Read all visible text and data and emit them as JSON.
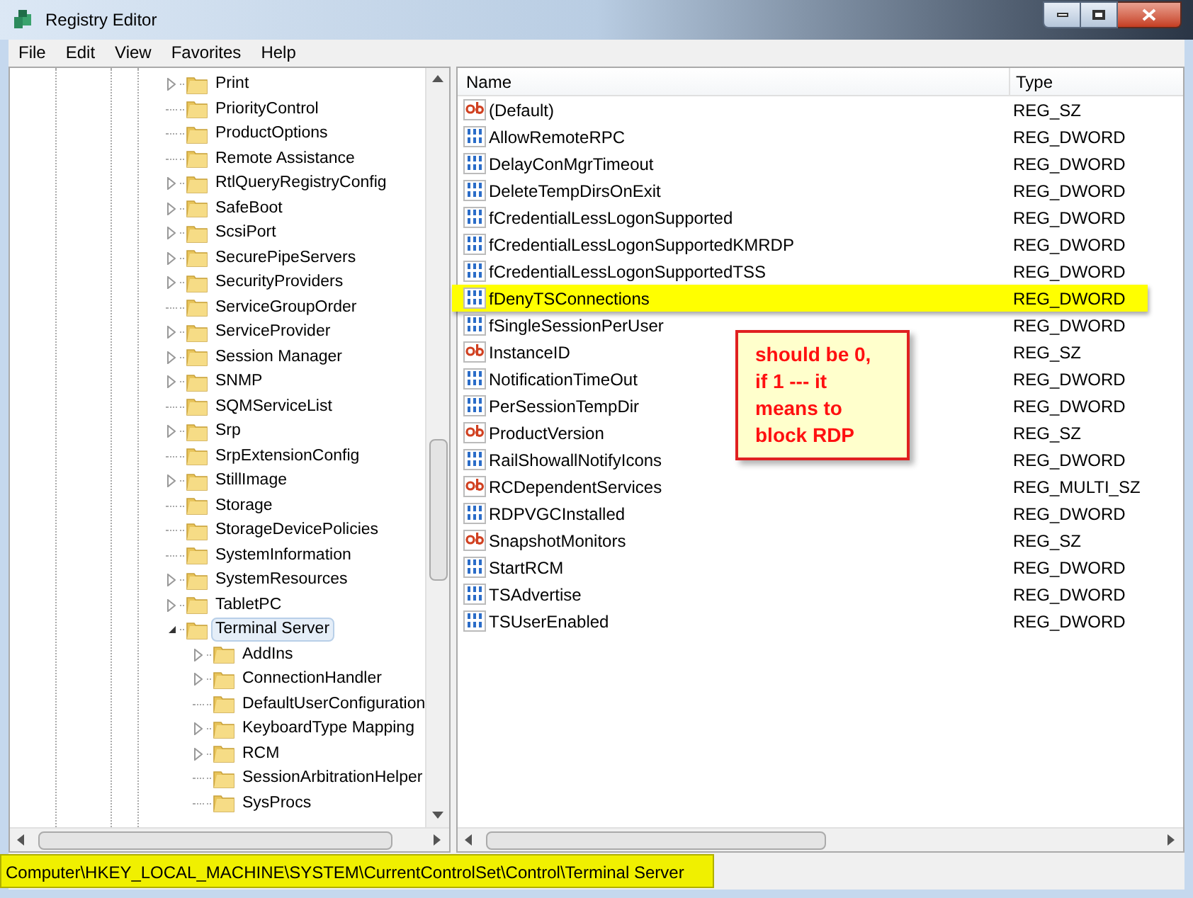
{
  "window": {
    "title": "Registry Editor"
  },
  "menu": [
    "File",
    "Edit",
    "View",
    "Favorites",
    "Help"
  ],
  "tree": [
    {
      "label": "Print",
      "expandable": true,
      "selected": false
    },
    {
      "label": "PriorityControl",
      "expandable": false,
      "selected": false
    },
    {
      "label": "ProductOptions",
      "expandable": false,
      "selected": false
    },
    {
      "label": "Remote Assistance",
      "expandable": false,
      "selected": false
    },
    {
      "label": "RtlQueryRegistryConfig",
      "expandable": true,
      "selected": false
    },
    {
      "label": "SafeBoot",
      "expandable": true,
      "selected": false
    },
    {
      "label": "ScsiPort",
      "expandable": true,
      "selected": false
    },
    {
      "label": "SecurePipeServers",
      "expandable": true,
      "selected": false
    },
    {
      "label": "SecurityProviders",
      "expandable": true,
      "selected": false
    },
    {
      "label": "ServiceGroupOrder",
      "expandable": false,
      "selected": false
    },
    {
      "label": "ServiceProvider",
      "expandable": true,
      "selected": false
    },
    {
      "label": "Session Manager",
      "expandable": true,
      "selected": false
    },
    {
      "label": "SNMP",
      "expandable": true,
      "selected": false
    },
    {
      "label": "SQMServiceList",
      "expandable": false,
      "selected": false
    },
    {
      "label": "Srp",
      "expandable": true,
      "selected": false
    },
    {
      "label": "SrpExtensionConfig",
      "expandable": false,
      "selected": false
    },
    {
      "label": "StillImage",
      "expandable": true,
      "selected": false
    },
    {
      "label": "Storage",
      "expandable": false,
      "selected": false
    },
    {
      "label": "StorageDevicePolicies",
      "expandable": false,
      "selected": false
    },
    {
      "label": "SystemInformation",
      "expandable": false,
      "selected": false
    },
    {
      "label": "SystemResources",
      "expandable": true,
      "selected": false
    },
    {
      "label": "TabletPC",
      "expandable": true,
      "selected": false
    },
    {
      "label": "Terminal Server",
      "expandable": true,
      "expanded": true,
      "selected": true,
      "children": [
        {
          "label": "AddIns",
          "expandable": true,
          "selected": false
        },
        {
          "label": "ConnectionHandler",
          "expandable": true,
          "selected": false
        },
        {
          "label": "DefaultUserConfiguration",
          "expandable": false,
          "selected": false
        },
        {
          "label": "KeyboardType Mapping",
          "expandable": true,
          "selected": false
        },
        {
          "label": "RCM",
          "expandable": true,
          "selected": false
        },
        {
          "label": "SessionArbitrationHelper",
          "expandable": false,
          "selected": false
        },
        {
          "label": "SysProcs",
          "expandable": false,
          "selected": false
        }
      ]
    }
  ],
  "table": {
    "columns": [
      "Name",
      "Type"
    ],
    "rows": [
      {
        "name": "(Default)",
        "type": "REG_SZ",
        "kind": "string",
        "highlighted": false
      },
      {
        "name": "AllowRemoteRPC",
        "type": "REG_DWORD",
        "kind": "binary",
        "highlighted": false
      },
      {
        "name": "DelayConMgrTimeout",
        "type": "REG_DWORD",
        "kind": "binary",
        "highlighted": false
      },
      {
        "name": "DeleteTempDirsOnExit",
        "type": "REG_DWORD",
        "kind": "binary",
        "highlighted": false
      },
      {
        "name": "fCredentialLessLogonSupported",
        "type": "REG_DWORD",
        "kind": "binary",
        "highlighted": false
      },
      {
        "name": "fCredentialLessLogonSupportedKMRDP",
        "type": "REG_DWORD",
        "kind": "binary",
        "highlighted": false
      },
      {
        "name": "fCredentialLessLogonSupportedTSS",
        "type": "REG_DWORD",
        "kind": "binary",
        "highlighted": false
      },
      {
        "name": "fDenyTSConnections",
        "type": "REG_DWORD",
        "kind": "binary",
        "highlighted": true
      },
      {
        "name": "fSingleSessionPerUser",
        "type": "REG_DWORD",
        "kind": "binary",
        "highlighted": false
      },
      {
        "name": "InstanceID",
        "type": "REG_SZ",
        "kind": "string",
        "highlighted": false
      },
      {
        "name": "NotificationTimeOut",
        "type": "REG_DWORD",
        "kind": "binary",
        "highlighted": false
      },
      {
        "name": "PerSessionTempDir",
        "type": "REG_DWORD",
        "kind": "binary",
        "highlighted": false
      },
      {
        "name": "ProductVersion",
        "type": "REG_SZ",
        "kind": "string",
        "highlighted": false
      },
      {
        "name": "RailShowallNotifyIcons",
        "type": "REG_DWORD",
        "kind": "binary",
        "highlighted": false
      },
      {
        "name": "RCDependentServices",
        "type": "REG_MULTI_SZ",
        "kind": "string",
        "highlighted": false
      },
      {
        "name": "RDPVGCInstalled",
        "type": "REG_DWORD",
        "kind": "binary",
        "highlighted": false
      },
      {
        "name": "SnapshotMonitors",
        "type": "REG_SZ",
        "kind": "string",
        "highlighted": false
      },
      {
        "name": "StartRCM",
        "type": "REG_DWORD",
        "kind": "binary",
        "highlighted": false
      },
      {
        "name": "TSAdvertise",
        "type": "REG_DWORD",
        "kind": "binary",
        "highlighted": false
      },
      {
        "name": "TSUserEnabled",
        "type": "REG_DWORD",
        "kind": "binary",
        "highlighted": false
      }
    ]
  },
  "callout": {
    "lines": [
      "should be 0,",
      "if 1 --- it",
      "means to",
      "block RDP"
    ]
  },
  "status_bar": {
    "path": "Computer\\HKEY_LOCAL_MACHINE\\SYSTEM\\CurrentControlSet\\Control\\Terminal Server",
    "highlighted": true
  }
}
